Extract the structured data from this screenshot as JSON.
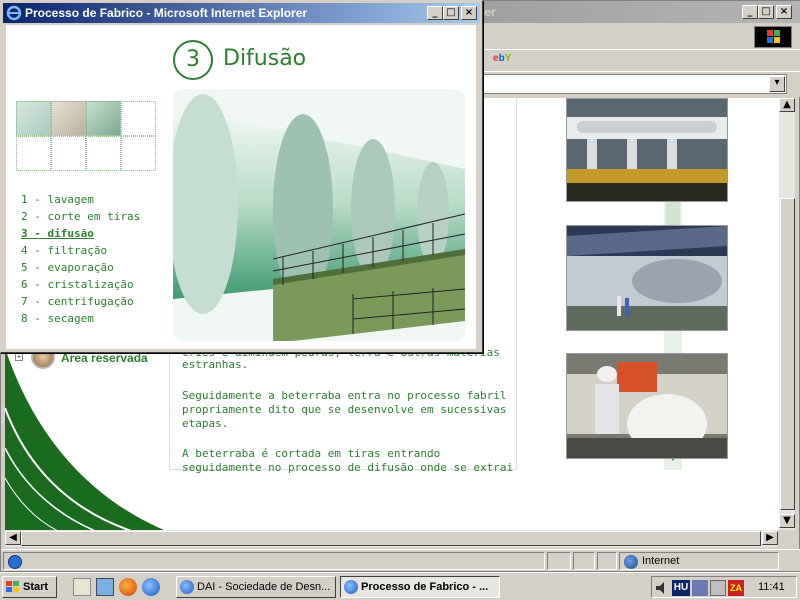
{
  "background_window": {
    "title_visible": "lorer",
    "links_visible": "ebY",
    "area_reservada": "Área reservada",
    "paragraphs": [
      "estranhas.",
      "Seguidamente a beterraba entra no processo fabril\npropriamente dito que se desenvolve em sucessivas\netapas.",
      "A beterraba é cortada em tiras entrando\nseguidamente no processo de difusão onde se extrai"
    ],
    "partial_paragraph_top": "cries e diminuem pedras, terra e outras materias",
    "photos": [
      "factory-pipes-photo",
      "factory-hall-photo",
      "workers-bagging-photo"
    ],
    "status_zone": "Internet"
  },
  "popup": {
    "title": "Processo de Fabrico - Microsoft Internet Explorer",
    "step_number": "3",
    "step_title": "Difusão",
    "steps": [
      {
        "label": "1 - lavagem",
        "active": false
      },
      {
        "label": "2 - corte em tiras",
        "active": false
      },
      {
        "label": "3 - difusão",
        "active": true
      },
      {
        "label": "4 - filtração",
        "active": false
      },
      {
        "label": "5 - evaporação",
        "active": false
      },
      {
        "label": "6 - cristalização",
        "active": false
      },
      {
        "label": "7 - centrifugação",
        "active": false
      },
      {
        "label": "8 - secagem",
        "active": false
      }
    ],
    "controls": {
      "minimize": "_",
      "maximize": "□",
      "close": "×"
    }
  },
  "taskbar": {
    "start_label": "Start",
    "tasks": [
      {
        "label": "DAI - Sociedade de Desn...",
        "active": false
      },
      {
        "label": "Processo de Fabrico - ...",
        "active": true
      }
    ],
    "tray": {
      "language": "HU",
      "clock": "11:41",
      "za": "ZA"
    }
  },
  "colors": {
    "accent_green": "#2e7d32",
    "title_active": "#0a246a"
  }
}
